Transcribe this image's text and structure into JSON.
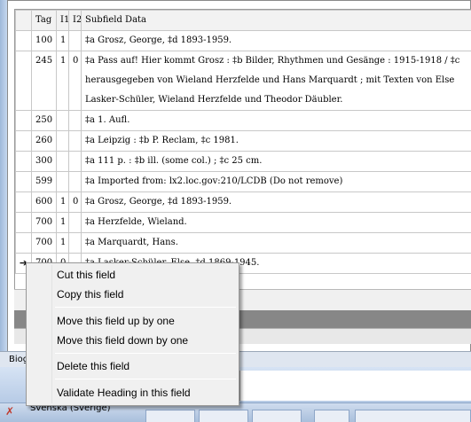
{
  "grid": {
    "headers": [
      "",
      "Tag",
      "I1",
      "I2",
      "Subfield Data"
    ],
    "rows": [
      {
        "sel": "",
        "tag": "100",
        "i1": "1",
        "i2": "",
        "data": "‡a Grosz, George, ‡d 1893-1959."
      },
      {
        "sel": "",
        "tag": "245",
        "i1": "1",
        "i2": "0",
        "data": "‡a Pass auf! Hier kommt Grosz : ‡b Bilder, Rhythmen und Gesänge : 1915-1918 / ‡c herausgegeben von Wieland Herzfelde und Hans Marquardt ; mit Texten von Else Lasker-Schüler, Wieland Herzfelde und Theodor Däubler."
      },
      {
        "sel": "",
        "tag": "250",
        "i1": "",
        "i2": "",
        "data": "‡a 1. Aufl."
      },
      {
        "sel": "",
        "tag": "260",
        "i1": "",
        "i2": "",
        "data": "‡a Leipzig : ‡b P. Reclam, ‡c 1981."
      },
      {
        "sel": "",
        "tag": "300",
        "i1": "",
        "i2": "",
        "data": "‡a 111 p. : ‡b ill. (some col.) ; ‡c 25 cm."
      },
      {
        "sel": "",
        "tag": "599",
        "i1": "",
        "i2": "",
        "data": "‡a Imported from: lx2.loc.gov:210/LCDB (Do not remove)"
      },
      {
        "sel": "",
        "tag": "600",
        "i1": "1",
        "i2": "0",
        "data": "‡a Grosz, George, ‡d 1893-1959."
      },
      {
        "sel": "",
        "tag": "700",
        "i1": "1",
        "i2": "",
        "data": "‡a Herzfelde, Wieland."
      },
      {
        "sel": "",
        "tag": "700",
        "i1": "1",
        "i2": "",
        "data": "‡a Marquardt, Hans."
      },
      {
        "sel": "➔",
        "tag": "700",
        "i1": "0",
        "i2": "",
        "data": "‡a Lasker-Schüler, Else, ‡d 1869-1945."
      }
    ]
  },
  "status": {
    "label": "Biog"
  },
  "taskbar": {
    "language": "Svenska (Sverige)"
  },
  "context_menu": {
    "items": [
      {
        "label": "Cut this field"
      },
      {
        "label": "Copy this field"
      },
      {
        "label": "Move this field up by one"
      },
      {
        "label": "Move this field down by one"
      },
      {
        "label": "Delete this field"
      },
      {
        "label": "Validate Heading in this field"
      }
    ]
  }
}
